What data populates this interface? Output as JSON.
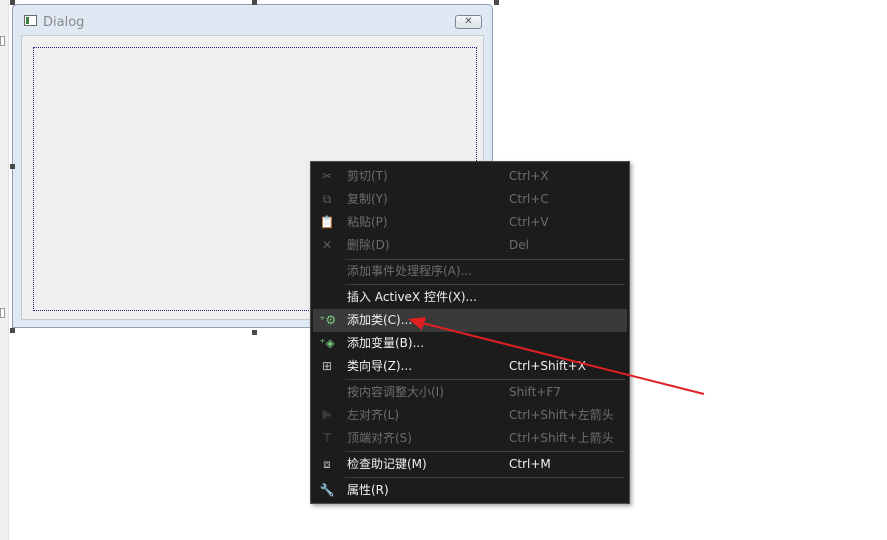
{
  "dialog": {
    "title": "Dialog",
    "close_glyph": "✕",
    "icon": "dialog-window-icon"
  },
  "context_menu": {
    "items": [
      {
        "icon": "scissors-icon",
        "glyph": "✂",
        "label": "剪切(T)",
        "shortcut": "Ctrl+X",
        "enabled": false
      },
      {
        "icon": "copy-icon",
        "glyph": "⧉",
        "label": "复制(Y)",
        "shortcut": "Ctrl+C",
        "enabled": false
      },
      {
        "icon": "paste-icon",
        "glyph": "📋",
        "label": "粘贴(P)",
        "shortcut": "Ctrl+V",
        "enabled": false
      },
      {
        "icon": "delete-icon",
        "glyph": "✕",
        "label": "删除(D)",
        "shortcut": "Del",
        "enabled": false
      },
      {
        "icon": "",
        "glyph": "",
        "label": "添加事件处理程序(A)...",
        "shortcut": "",
        "enabled": false
      },
      {
        "icon": "",
        "glyph": "",
        "label": "插入 ActiveX 控件(X)...",
        "shortcut": "",
        "enabled": true
      },
      {
        "icon": "add-class-icon",
        "glyph": "⁺⚙",
        "label": "添加类(C)...",
        "shortcut": "",
        "enabled": true,
        "highlighted": true
      },
      {
        "icon": "add-variable-icon",
        "glyph": "⁺◈",
        "label": "添加变量(B)...",
        "shortcut": "",
        "enabled": true
      },
      {
        "icon": "class-wizard-icon",
        "glyph": "⊞",
        "label": "类向导(Z)...",
        "shortcut": "Ctrl+Shift+X",
        "enabled": true
      },
      {
        "icon": "",
        "glyph": "",
        "label": "按内容调整大小(I)",
        "shortcut": "Shift+F7",
        "enabled": false
      },
      {
        "icon": "align-left-icon",
        "glyph": "⊫",
        "label": "左对齐(L)",
        "shortcut": "Ctrl+Shift+左箭头",
        "enabled": false
      },
      {
        "icon": "align-top-icon",
        "glyph": "⊤",
        "label": "顶端对齐(S)",
        "shortcut": "Ctrl+Shift+上箭头",
        "enabled": false
      },
      {
        "icon": "check-mnemonics-icon",
        "glyph": "⧈",
        "label": "检查助记键(M)",
        "shortcut": "Ctrl+M",
        "enabled": true
      },
      {
        "icon": "wrench-icon",
        "glyph": "🔧",
        "label": "属性(R)",
        "shortcut": "",
        "enabled": true
      }
    ]
  },
  "annotation": {
    "arrow_color": "#e02020"
  }
}
